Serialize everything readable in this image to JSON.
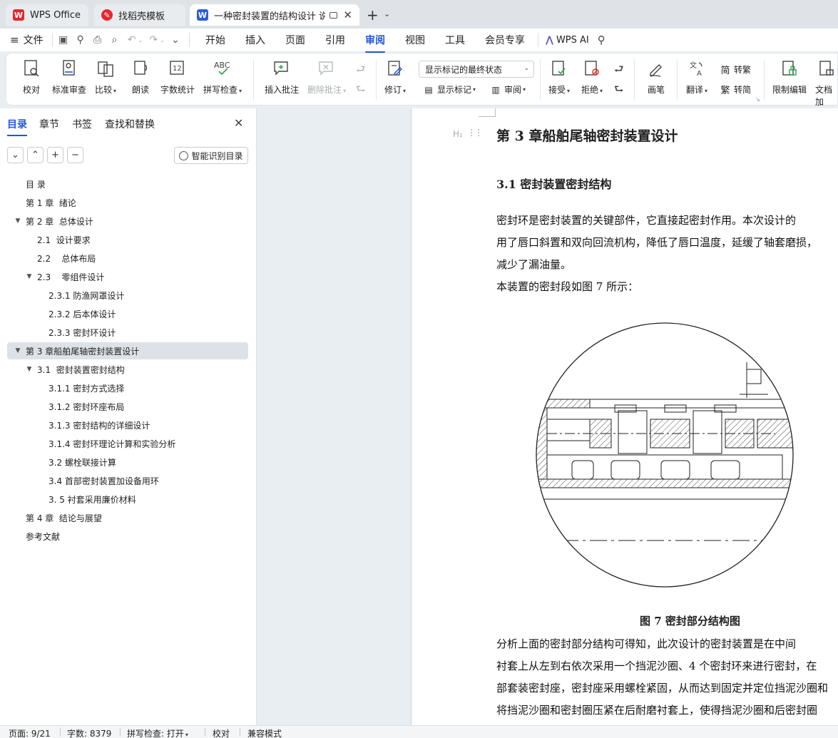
{
  "tabs": [
    {
      "label": "WPS Office",
      "icon": "wps-logo-icon",
      "color": "#e8262d"
    },
    {
      "label": "找稻壳模板",
      "icon": "docer-icon",
      "color": "#e8262d"
    },
    {
      "label": "一种密封装置的结构设计 说明",
      "icon": "word-doc-icon",
      "color": "#2b5ed8"
    }
  ],
  "menu": {
    "file": "文件",
    "items": [
      "开始",
      "插入",
      "页面",
      "引用",
      "审阅",
      "视图",
      "工具",
      "会员专享"
    ],
    "active": "审阅",
    "wps_ai": "WPS AI"
  },
  "ribbon": {
    "proofread": "校对",
    "std_review": "标准审查",
    "compare": "比较",
    "read_aloud": "朗读",
    "word_count": "字数统计",
    "spell_check": "拼写检查",
    "insert_comment": "插入批注",
    "delete_comment": "删除批注",
    "track_changes": "修订",
    "markup_state": "显示标记的最终状态",
    "show_markup": "显示标记",
    "review_pane": "审阅",
    "accept": "接受",
    "reject": "拒绝",
    "ink": "画笔",
    "translate": "翻译",
    "to_traditional": "转繁",
    "to_simplified": "转简",
    "restrict_edit": "限制编辑",
    "doc_encrypt": "文档加"
  },
  "left_panel": {
    "tabs": [
      "目录",
      "章节",
      "书签",
      "查找和替换"
    ],
    "active_tab": "目录",
    "smart_toc": "智能识别目录",
    "toc": [
      {
        "label": "目 录",
        "level": 0,
        "expand": ""
      },
      {
        "label": "第 1 章  绪论",
        "level": 0,
        "expand": ""
      },
      {
        "label": "第 2 章  总体设计",
        "level": 0,
        "expand": "▼"
      },
      {
        "label": "2.1  设计要求",
        "level": 1,
        "expand": ""
      },
      {
        "label": "2.2    总体布局",
        "level": 1,
        "expand": ""
      },
      {
        "label": "2.3    零组件设计",
        "level": 1,
        "expand": "▼"
      },
      {
        "label": "2.3.1 防渔网罩设计",
        "level": 2,
        "expand": ""
      },
      {
        "label": "2.3.2 后本体设计",
        "level": 2,
        "expand": ""
      },
      {
        "label": "2.3.3 密封环设计",
        "level": 2,
        "expand": ""
      },
      {
        "label": "第 3 章船舶尾轴密封装置设计",
        "level": 0,
        "expand": "▼",
        "selected": true
      },
      {
        "label": "3.1  密封装置密封结构",
        "level": 1,
        "expand": "▼"
      },
      {
        "label": "3.1.1 密封方式选择",
        "level": 2,
        "expand": ""
      },
      {
        "label": "3.1.2 密封环座布局",
        "level": 2,
        "expand": ""
      },
      {
        "label": "3.1.3 密封结构的详细设计",
        "level": 2,
        "expand": ""
      },
      {
        "label": "3.1.4 密封环理论计算和实验分析",
        "level": 2,
        "expand": ""
      },
      {
        "label": "3.2 螺栓联接计算",
        "level": 2,
        "expand": ""
      },
      {
        "label": "3.4 首部密封装置加设备用环",
        "level": 2,
        "expand": ""
      },
      {
        "label": "3. 5 衬套采用廉价材料",
        "level": 2,
        "expand": ""
      },
      {
        "label": "第 4 章  结论与展望",
        "level": 0,
        "expand": ""
      },
      {
        "label": "参考文献",
        "level": 0,
        "expand": ""
      }
    ]
  },
  "document": {
    "heading1": "第 3 章船舶尾轴密封装置设计",
    "heading2": "3.1  密封装置密封结构",
    "para1": [
      "        密封环是密封装置的关键部件，它直接起密封作用。本次设计的",
      "用了唇口斜置和双向回流机构，降低了唇口温度，延缓了轴套磨损，",
      "减少了漏油量。"
    ],
    "para2": "        本装置的密封段如图 7 所示：",
    "caption": "图 7 密封部分结构图",
    "para3": [
      "        分析上面的密封部分结构可得知，此次设计的密封装置是在中间",
      "衬套上从左到右依次采用一个挡泥沙圈、4 个密封环来进行密封，在",
      "部套装密封座，密封座采用螺栓紧固，从而达到固定并定位挡泥沙圈和",
      "将挡泥沙圈和密封圈压紧在后耐磨衬套上，使得挡泥沙圈和后密封圈"
    ]
  },
  "status": {
    "page": "页面: 9/21",
    "words": "字数: 8379",
    "spell": "拼写检查: 打开",
    "proof": "校对",
    "compat": "兼容模式"
  },
  "colors": {
    "accent": "#2456d8",
    "wps_red": "#e8262d"
  }
}
